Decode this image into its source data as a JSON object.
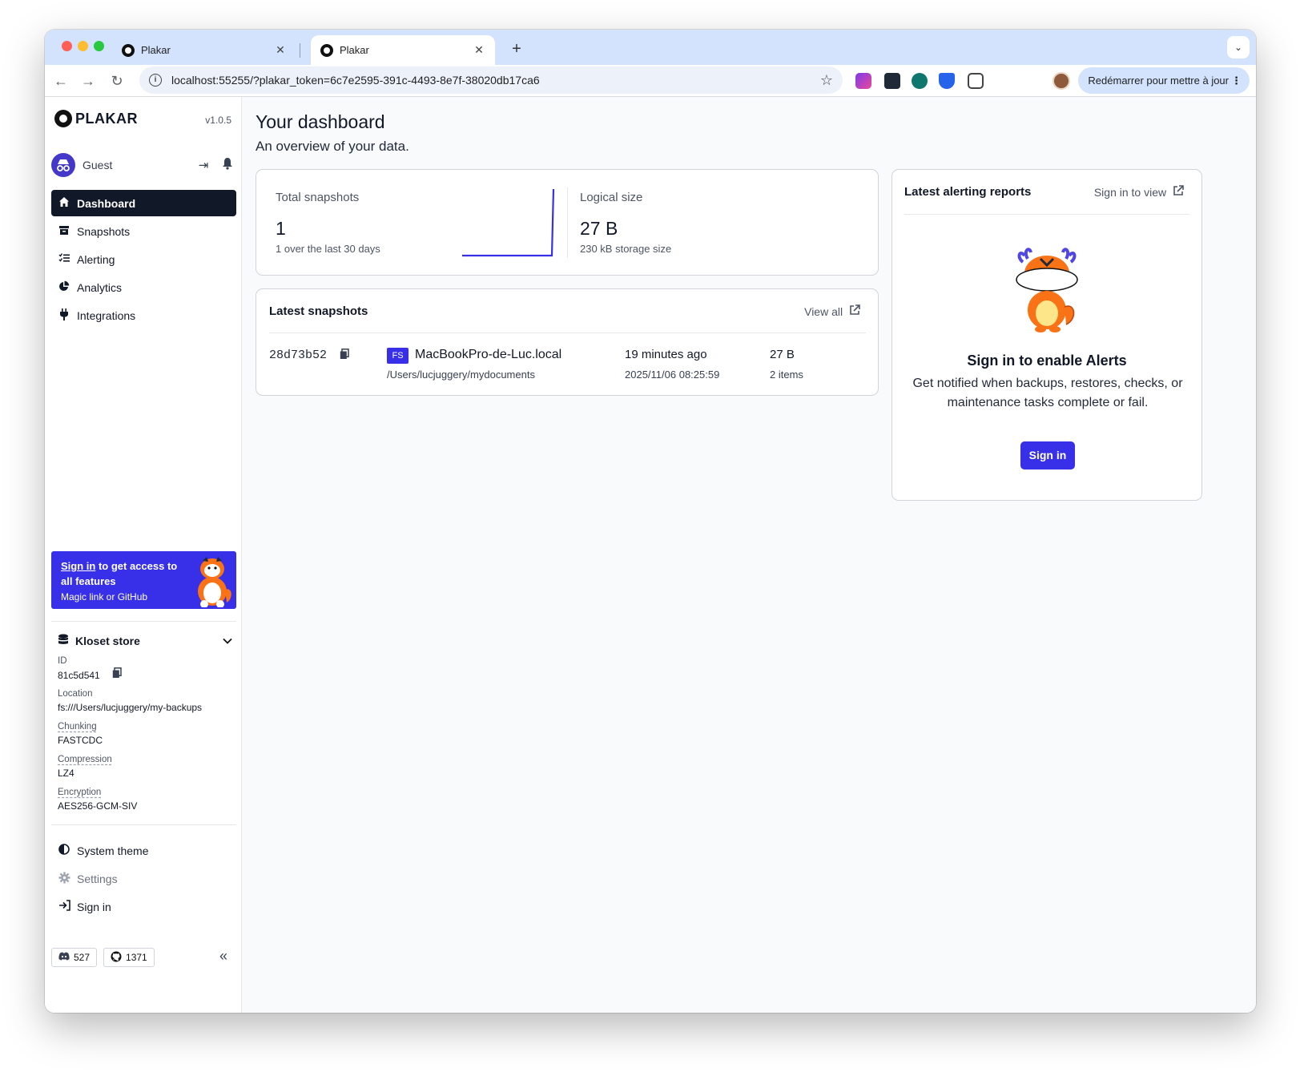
{
  "browser": {
    "tabs": [
      {
        "title": "Plakar",
        "close": "✕"
      },
      {
        "title": "Plakar",
        "close": "✕"
      }
    ],
    "new_tab": "+",
    "tab_menu": "⌄",
    "url": "localhost:55255/?plakar_token=6c7e2595-391c-4493-8e7f-38020db17ca6",
    "update_button": "Redémarrer pour mettre à jour"
  },
  "sidebar": {
    "brand": "PLAKAR",
    "version": "v1.0.5",
    "user": "Guest",
    "nav": [
      {
        "label": "Dashboard",
        "icon": "home-icon"
      },
      {
        "label": "Snapshots",
        "icon": "archive-icon"
      },
      {
        "label": "Alerting",
        "icon": "list-check-icon"
      },
      {
        "label": "Analytics",
        "icon": "pie-chart-icon"
      },
      {
        "label": "Integrations",
        "icon": "plug-icon"
      }
    ],
    "promo": {
      "link": "Sign in",
      "text": " to get access to all features",
      "sub": "Magic link or GitHub"
    },
    "store": {
      "title": "Kloset store",
      "id_label": "ID",
      "id_value": "81c5d541",
      "location_label": "Location",
      "location_value": "fs:///Users/lucjuggery/my-backups",
      "chunking_label": "Chunking",
      "chunking_value": "FASTCDC",
      "compression_label": "Compression",
      "compression_value": "LZ4",
      "encryption_label": "Encryption",
      "encryption_value": "AES256-GCM-SIV"
    },
    "bottom_nav": [
      {
        "label": "System theme",
        "icon": "half-circle-icon"
      },
      {
        "label": "Settings",
        "icon": "gear-icon"
      },
      {
        "label": "Sign in",
        "icon": "sign-in-icon"
      }
    ],
    "discord_count": "527",
    "github_count": "1371"
  },
  "main": {
    "title": "Your dashboard",
    "subtitle": "An overview of your data.",
    "stats": {
      "total_label": "Total snapshots",
      "total_value": "1",
      "total_sub": "1 over the last 30 days",
      "logical_label": "Logical size",
      "logical_value": "27 B",
      "logical_sub": "230 kB storage size"
    },
    "latest": {
      "title": "Latest snapshots",
      "view_all": "View all",
      "rows": [
        {
          "id": "28d73b52",
          "type": "FS",
          "host": "MacBookPro-de-Luc.local",
          "path": "/Users/lucjuggery/mydocuments",
          "ago": "19 minutes ago",
          "date": "2025/11/06 08:25:59",
          "size": "27 B",
          "items": "2 items"
        }
      ]
    },
    "alerts": {
      "title": "Latest alerting reports",
      "sign_in_to_view": "Sign in to view",
      "heading": "Sign in to enable Alerts",
      "text": "Get notified when backups, restores, checks, or maintenance tasks complete or fail.",
      "button": "Sign in"
    }
  },
  "colors": {
    "accent": "#3730e8",
    "nav_active_bg": "#111827",
    "tabstrip": "#d3e3fd"
  }
}
